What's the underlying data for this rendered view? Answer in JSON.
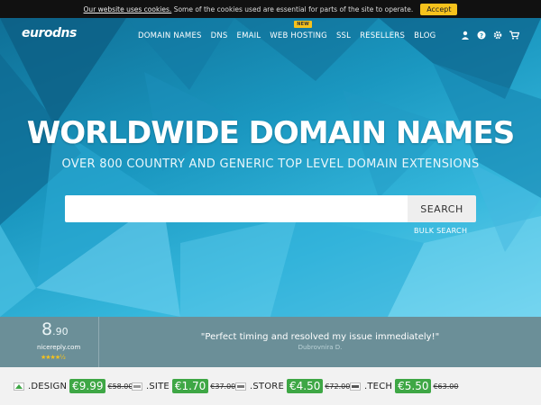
{
  "cookie_bar": {
    "link_text": "Our website uses cookies.",
    "text": "Some of the cookies used are essential for parts of the site to operate.",
    "accept_label": "Accept"
  },
  "header": {
    "logo": "eurodns",
    "nav": {
      "domain_names": "DOMAIN NAMES",
      "dns": "DNS",
      "email": "EMAIL",
      "web_hosting": "WEB HOSTING",
      "web_hosting_badge": "NEW",
      "ssl": "SSL",
      "resellers": "RESELLERS",
      "blog": "BLOG"
    }
  },
  "hero": {
    "title": "WORLDWIDE DOMAIN NAMES",
    "subtitle": "OVER 800 COUNTRY AND GENERIC TOP LEVEL DOMAIN EXTENSIONS",
    "search_placeholder": "",
    "search_button": "SEARCH",
    "bulk_search": "BULK SEARCH"
  },
  "review": {
    "score_int": "8",
    "score_dec": ".90",
    "source": "nicereply.com",
    "stars": "★★★★½",
    "quote": "\"Perfect timing and resolved my issue immediately!\"",
    "author": "Dubrovnira D."
  },
  "promos": [
    {
      "icon": "design",
      "tld": ".DESIGN",
      "price": "€9.99",
      "old_price": "€58.00"
    },
    {
      "icon": "site",
      "tld": ".SITE",
      "price": "€1.70",
      "old_price": "€37.00"
    },
    {
      "icon": "store",
      "tld": ".STORE",
      "price": "€4.50",
      "old_price": "€72.00"
    },
    {
      "icon": "tech",
      "tld": ".TECH",
      "price": "€5.50",
      "old_price": "€63.00"
    }
  ],
  "colors": {
    "accent_yellow": "#f6c21c",
    "price_green": "#3ea745",
    "hero_blue": "#1a97c0"
  }
}
